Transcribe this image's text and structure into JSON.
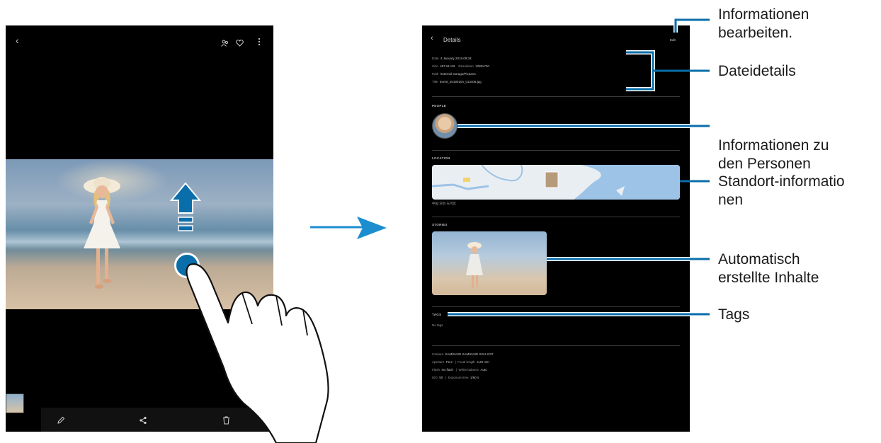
{
  "left_phone": {
    "photo_alt": "photo"
  },
  "right_phone": {
    "title": "Details",
    "edit_label": "Edit",
    "file_info": [
      {
        "k": "Date",
        "v": "4 January 2019 09:34"
      },
      {
        "k": "Size",
        "v": "497.61 KB",
        "k2": "Resolution",
        "v2": "1280x720"
      },
      {
        "k": "Path",
        "v": "/Internal storage/Pictures"
      },
      {
        "k": "Title",
        "v": "Event_20190104_013406.jpg"
      }
    ],
    "sections": {
      "people": "PEOPLE",
      "location": "LOCATION",
      "stories": "STORIES",
      "tags": "TAGS"
    },
    "location_caption": "中国 深圳 天河区",
    "tags_value": "No tags",
    "camera_info": [
      {
        "k": "Camera",
        "v": "SAMSUNG SAMSUNG SGH-I337"
      },
      {
        "k": "Aperture",
        "v": "F2.2",
        "k2": "Focal length",
        "v2": "4.20 mm"
      },
      {
        "k": "Flash",
        "v": "No flash",
        "k2": "White balance",
        "v2": "Auto"
      },
      {
        "k": "ISO",
        "v": "50",
        "k2": "Exposure time",
        "v2": "1/60 s"
      }
    ]
  },
  "callouts": {
    "edit": "Informationen\nbearbeiten.",
    "file_details": "Dateidetails",
    "people": "Informationen zu\nden Personen",
    "location": "Standort-informatio\nnen",
    "stories": "Automatisch\nerstellte Inhalte",
    "tags": "Tags"
  },
  "colors": {
    "accent": "#0a6eaa",
    "callout_text": "#1a1a1a",
    "screen_bg": "#000000"
  }
}
